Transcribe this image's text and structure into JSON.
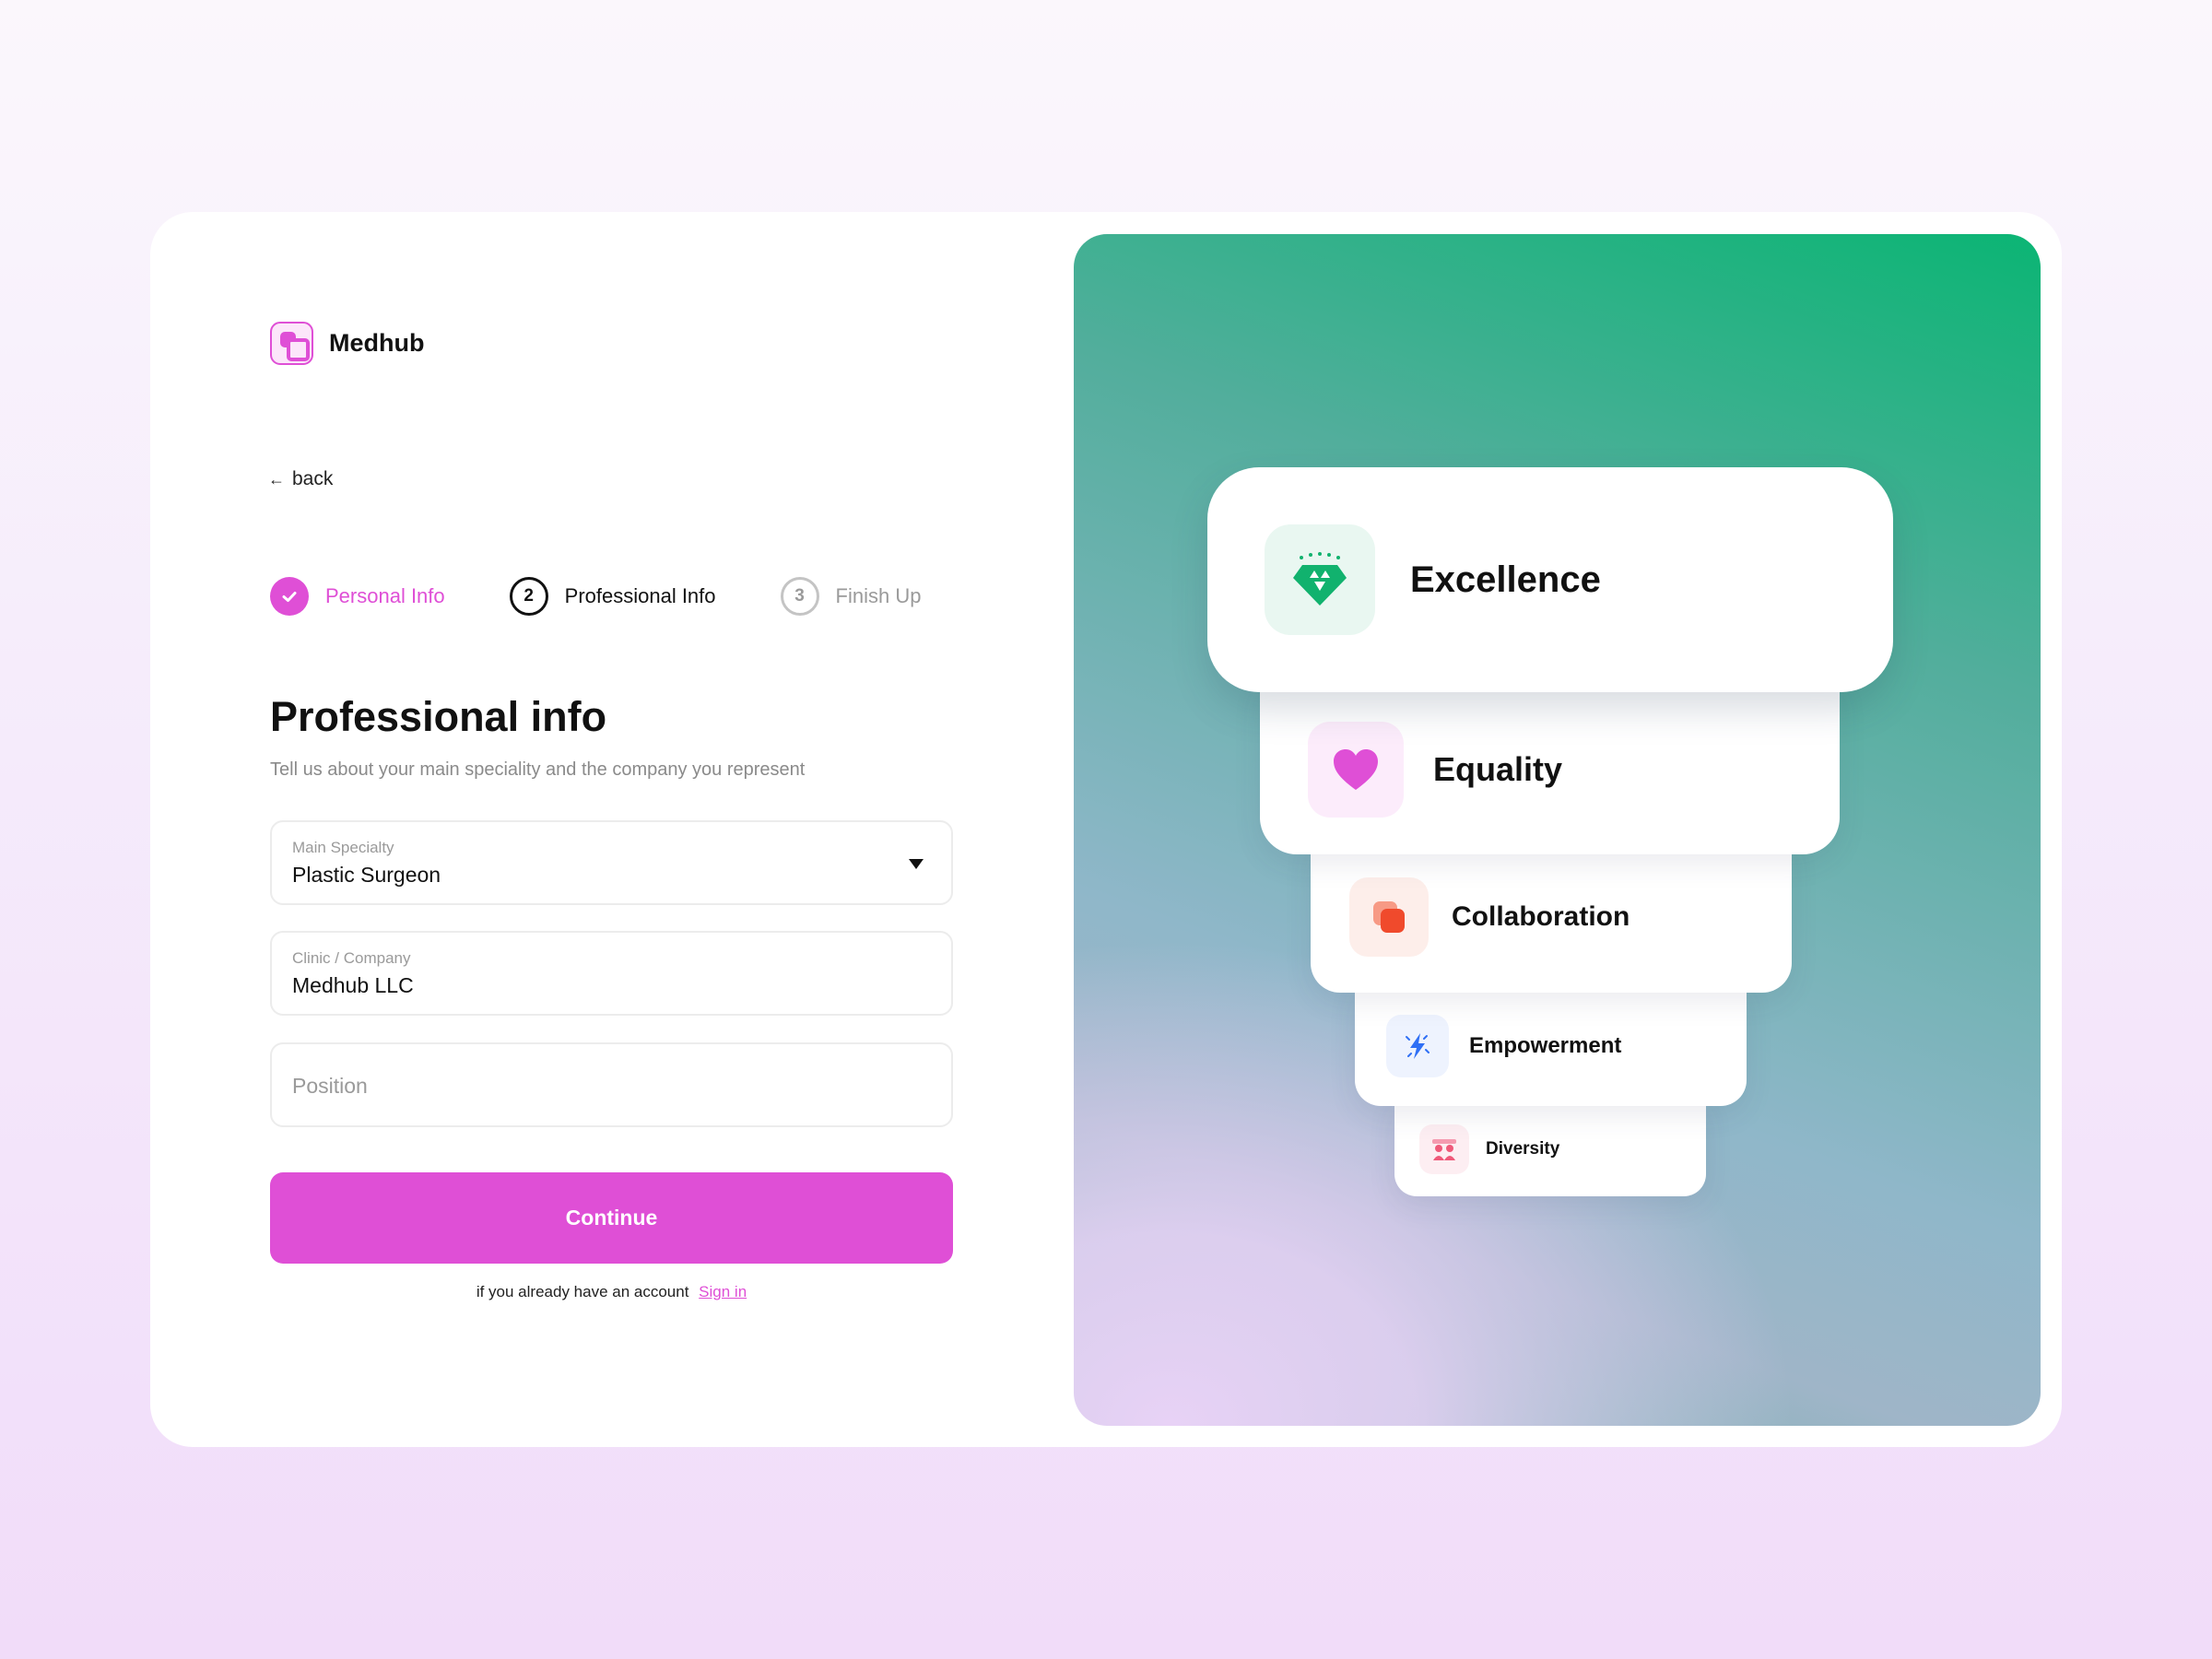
{
  "brand": {
    "name": "Medhub"
  },
  "nav": {
    "back_label": "back"
  },
  "steps": [
    {
      "number": "1",
      "label": "Personal Info",
      "status": "done"
    },
    {
      "number": "2",
      "label": "Professional Info",
      "status": "active"
    },
    {
      "number": "3",
      "label": "Finish Up",
      "status": "todo"
    }
  ],
  "form": {
    "title": "Professional info",
    "subtitle": "Tell us about your main speciality and the company you represent",
    "specialty": {
      "label": "Main Specialty",
      "value": "Plastic Surgeon"
    },
    "company": {
      "label": "Clinic / Company",
      "value": "Medhub LLC"
    },
    "position": {
      "placeholder": "Position"
    },
    "continue_label": "Continue",
    "signin_prompt": "if you already have an account",
    "signin_link": "Sign in"
  },
  "values": [
    {
      "label": "Excellence",
      "icon": "diamond-icon",
      "color": "#11b26e"
    },
    {
      "label": "Equality",
      "icon": "heart-icon",
      "color": "#df4fd6"
    },
    {
      "label": "Collaboration",
      "icon": "stacked-squares-icon",
      "color": "#f04a2c"
    },
    {
      "label": "Empowerment",
      "icon": "lightning-icon",
      "color": "#2f6ff5"
    },
    {
      "label": "Diversity",
      "icon": "people-icon",
      "color": "#ef5a7a"
    }
  ],
  "colors": {
    "accent": "#df4fd6",
    "background": "#f5ebfb"
  }
}
